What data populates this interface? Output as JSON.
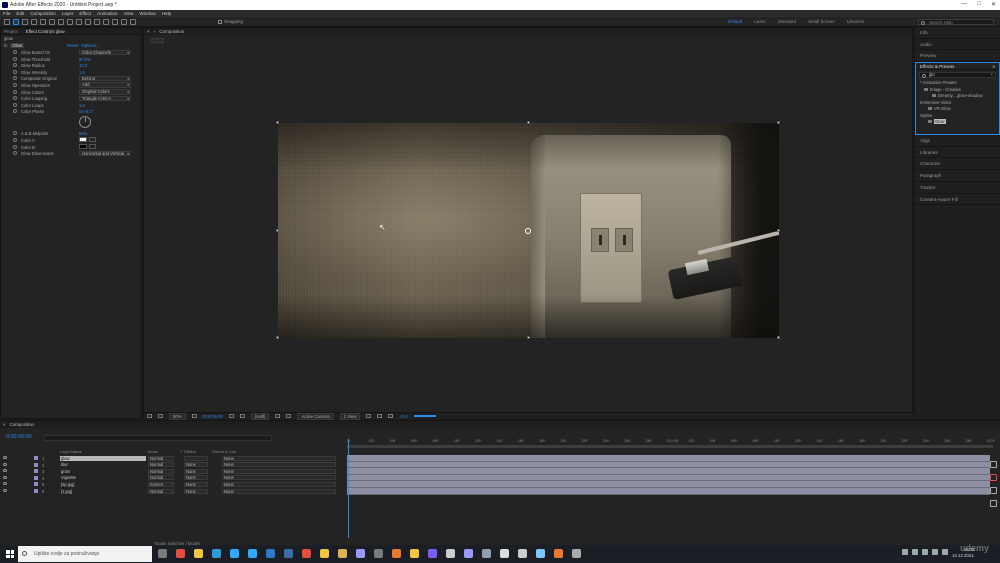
{
  "window": {
    "title": "Adobe After Effects 2020 - Untitled Project.aep *",
    "controls": [
      "—",
      "□",
      "✕"
    ]
  },
  "menu": [
    "File",
    "Edit",
    "Composition",
    "Layer",
    "Effect",
    "Animation",
    "View",
    "Window",
    "Help"
  ],
  "toolbar": {
    "snapping_label": "Snapping",
    "workspaces": [
      "Default",
      "Learn",
      "Standard",
      "Small Screen",
      "Libraries"
    ],
    "active_workspace": "Default",
    "search_placeholder": "Search Help"
  },
  "project_panel": {
    "tabs": [
      "Project",
      "Effect Controls glow"
    ],
    "comp_layer": "glow",
    "effect": {
      "name": "Glow",
      "reset": "Reset",
      "options": "Options..."
    },
    "properties": [
      {
        "label": "Glow Based On",
        "dropdown": "Color Channels"
      },
      {
        "label": "Glow Threshold",
        "value": "60.0%"
      },
      {
        "label": "Glow Radius",
        "value": "10.0"
      },
      {
        "label": "Glow Intensity",
        "value": "1.0"
      },
      {
        "label": "Composite Original",
        "dropdown": "Behind"
      },
      {
        "label": "Glow Operation",
        "dropdown": "Add"
      },
      {
        "label": "Glow Colors",
        "dropdown": "Original Colors"
      },
      {
        "label": "Color Looping",
        "dropdown": "Triangle A>B>A"
      },
      {
        "label": "Color Loops",
        "value": "1.0"
      },
      {
        "label": "Color Phase",
        "value": "0x+0.0°"
      },
      {
        "label": "A & B Midpoint",
        "value": "50%"
      },
      {
        "label": "Color A",
        "swatch": "#ffffff"
      },
      {
        "label": "Color B",
        "swatch": "#000000"
      },
      {
        "label": "Glow Dimensions",
        "dropdown": "Horizontal and Vertical"
      }
    ]
  },
  "composition_panel": {
    "tab_label": "Composition",
    "zoom": "50%",
    "timecode": "0;00;00;00",
    "resolution": "(Half)",
    "camera": "Active Camera",
    "views": "1 View",
    "offset": "+0.0"
  },
  "right_column": {
    "top_items": [
      "Info",
      "Audio",
      "Preview"
    ],
    "effects_presets": {
      "title": "Effects & Presets",
      "search_value": "glo",
      "tree": [
        {
          "label": "* Animation Presets",
          "indent": 1
        },
        {
          "label": "Image - Creative",
          "indent": 2
        },
        {
          "label": "Dreamy... glow+shadow",
          "indent": 3
        },
        {
          "label": "Immersive Video",
          "indent": 1
        },
        {
          "label": "VR Glow",
          "indent": 2
        },
        {
          "label": "Stylize",
          "indent": 1
        },
        {
          "label": "Glow",
          "indent": 2,
          "selected": true
        }
      ]
    },
    "bottom_items": [
      "Align",
      "Libraries",
      "Character",
      "Paragraph",
      "Tracker",
      "Content-Aware Fill"
    ]
  },
  "timeline": {
    "tab_label": "Composition",
    "timecode": "0;00;00;00",
    "columns": [
      "Layer Name",
      "Mode",
      "T TrkMat",
      "Parent & Link"
    ],
    "ruler_ticks": [
      "0f",
      "02f",
      "04f",
      "06f",
      "08f",
      "10f",
      "12f",
      "14f",
      "16f",
      "18f",
      "20f",
      "22f",
      "24f",
      "26f",
      "28f",
      "01:00f",
      "02f",
      "04f",
      "06f",
      "08f",
      "10f",
      "12f",
      "14f",
      "16f",
      "18f",
      "20f",
      "22f",
      "24f",
      "26f",
      "28f",
      "02:0"
    ],
    "layers": [
      {
        "num": "1",
        "name": "glow",
        "mode": "Normal",
        "trkmat": "",
        "parent": "None",
        "selected": true
      },
      {
        "num": "2",
        "name": "blur",
        "mode": "Normal",
        "trkmat": "None",
        "parent": "None"
      },
      {
        "num": "3",
        "name": "grain",
        "mode": "Normal",
        "trkmat": "None",
        "parent": "None"
      },
      {
        "num": "4",
        "name": "Vignette",
        "mode": "Normal",
        "trkmat": "None",
        "parent": "None"
      },
      {
        "num": "5",
        "name": "[2p.jpg]",
        "mode": "Screen",
        "trkmat": "None",
        "parent": "None"
      },
      {
        "num": "6",
        "name": "[1.jpg]",
        "mode": "Normal",
        "trkmat": "None",
        "parent": "None"
      }
    ],
    "toggle_label": "Toggle Switches / Modes"
  },
  "taskbar": {
    "search_placeholder": "Upišite ovdje za pretraživanje",
    "clock_time": "14:12",
    "clock_date": "14.12.2021.",
    "app_colors": [
      "#7a7a7a",
      "#e74c3c",
      "#f5c542",
      "#2e9bd8",
      "#31a8ff",
      "#31a8ff",
      "#2b78d0",
      "#3b6ea5",
      "#e74c3c",
      "#f5c542",
      "#e0b050",
      "#9999ff",
      "#7a7a7a",
      "#e8792d",
      "#f5c542",
      "#7b5cff",
      "#cccccc",
      "#9999ff",
      "#8fa0b0",
      "#dddddd",
      "#cccccc",
      "#7fc8ff",
      "#e8792d",
      "#aaaaaa"
    ]
  },
  "watermark": "udemy"
}
